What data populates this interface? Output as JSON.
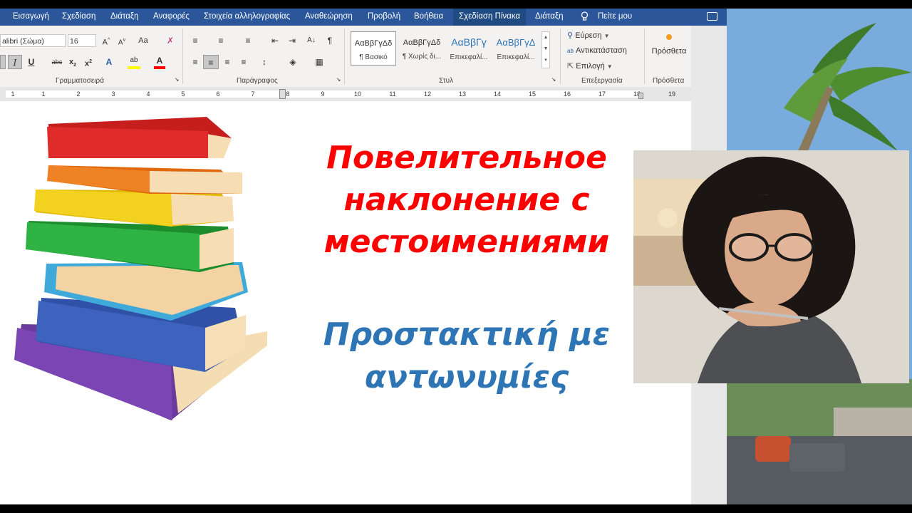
{
  "menu_tabs": [
    "Εισαγωγή",
    "Σχεδίαση",
    "Διάταξη",
    "Αναφορές",
    "Στοιχεία αλληλογραφίας",
    "Αναθεώρηση",
    "Προβολή",
    "Βοήθεια",
    "Σχεδίαση Πίνακα",
    "Διάταξη"
  ],
  "tell_me": "Πείτε μου",
  "font": {
    "name": "alibri (Σώμα)",
    "size": "16",
    "group_label": "Γραμματοσειρά",
    "case_label": "Aa"
  },
  "paragraph": {
    "group_label": "Παράγραφος"
  },
  "styles": {
    "group_label": "Στυλ",
    "items": [
      {
        "preview": "ΑαΒβΓγΔδ",
        "name": "¶ Βασικό"
      },
      {
        "preview": "ΑαΒβΓγΔδ",
        "name": "¶ Χωρίς δι..."
      },
      {
        "preview": "ΑαΒβΓγ",
        "name": "Επικεφαλί..."
      },
      {
        "preview": "ΑαΒβΓγΔ",
        "name": "Επικεφαλί..."
      }
    ]
  },
  "editing": {
    "group_label": "Επεξεργασία",
    "find": "Εύρεση",
    "replace": "Αντικατάσταση",
    "select": "Επιλογή"
  },
  "addins": {
    "label": "Πρόσθετα",
    "group_label": "Πρόσθετα"
  },
  "ruler_numbers": [
    "1",
    "1",
    "2",
    "3",
    "4",
    "5",
    "6",
    "7",
    "8",
    "9",
    "10",
    "11",
    "12",
    "13",
    "14",
    "15",
    "16",
    "17",
    "18",
    "19"
  ],
  "document": {
    "title_ru": [
      "Повелительное",
      "наклонение с",
      "местоимениями"
    ],
    "title_gr": [
      "Προστακτική με",
      "αντωνυμίες"
    ]
  },
  "colors": {
    "ribbon_blue": "#2b579a",
    "russian_title": "#ff0000",
    "greek_title": "#2e75b6"
  }
}
